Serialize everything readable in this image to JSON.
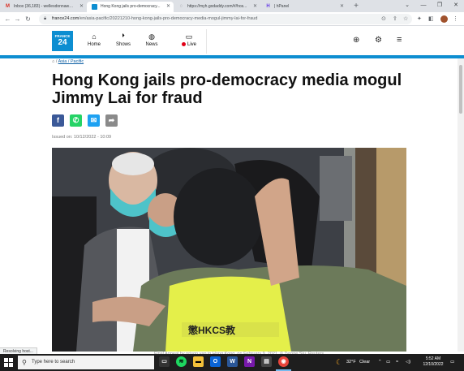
{
  "browser": {
    "tabs": [
      {
        "label": "Inbox (36,183) - wellesdonnaw@...",
        "icon": "gmail-icon",
        "color": "#d93025",
        "glyph": "M"
      },
      {
        "label": "Hong Kong jails pro-democracy...",
        "icon": "france24-icon",
        "color": "#0d8ed1",
        "glyph": "▪",
        "active": true
      },
      {
        "label": "https://myh.godaddy.com/#/hos...",
        "icon": "loading-icon",
        "color": "#5f6368",
        "glyph": "◌"
      },
      {
        "label": "| hPanel",
        "icon": "hpanel-icon",
        "color": "#673de6",
        "glyph": "H"
      }
    ],
    "new_tab": "+",
    "url_host": "france24.com",
    "url_path": "/en/asia-pacific/20221210-hong-kong-jails-pro-democracy-media-mogul-jimmy-lai-for-fraud"
  },
  "site": {
    "logo_top": "FRANCE",
    "logo_num": "24",
    "nav": [
      {
        "label": "Home",
        "icon": "home-icon",
        "glyph": "⌂"
      },
      {
        "label": "Shows",
        "icon": "play-icon",
        "glyph": "▶"
      },
      {
        "label": "News",
        "icon": "globe-icon",
        "glyph": "◍"
      },
      {
        "label": "Live",
        "icon": "tv-icon",
        "glyph": "▭"
      }
    ],
    "accent": "#0d8ed1"
  },
  "article": {
    "breadcrumb_section": "Asia / Pacific",
    "headline": "Hong Kong jails pro-democracy media mogul Jimmy Lai for fraud",
    "issued": "Issued on: 10/12/2022 - 10:09",
    "share": [
      {
        "name": "facebook-share-button",
        "glyph": "f",
        "color": "#3b5998"
      },
      {
        "name": "whatsapp-share-button",
        "glyph": "✆",
        "color": "#25d366"
      },
      {
        "name": "twitter-share-button",
        "glyph": "t",
        "color": "#1da1f2"
      },
      {
        "name": "share-button",
        "glyph": "➦",
        "color": "#8a8a8a"
      }
    ],
    "vest_text": "懲HKCS教",
    "caption": "Final Appeal by prison van in Hong Kong, on February 9, 2021. © Tyrone Siu, Reuters"
  },
  "status_text": "Resolving host...",
  "taskbar": {
    "search_placeholder": "Type here to search",
    "weather_temp": "32°F",
    "weather_text": "Clear",
    "time": "5:52 AM",
    "date": "12/10/2022"
  }
}
